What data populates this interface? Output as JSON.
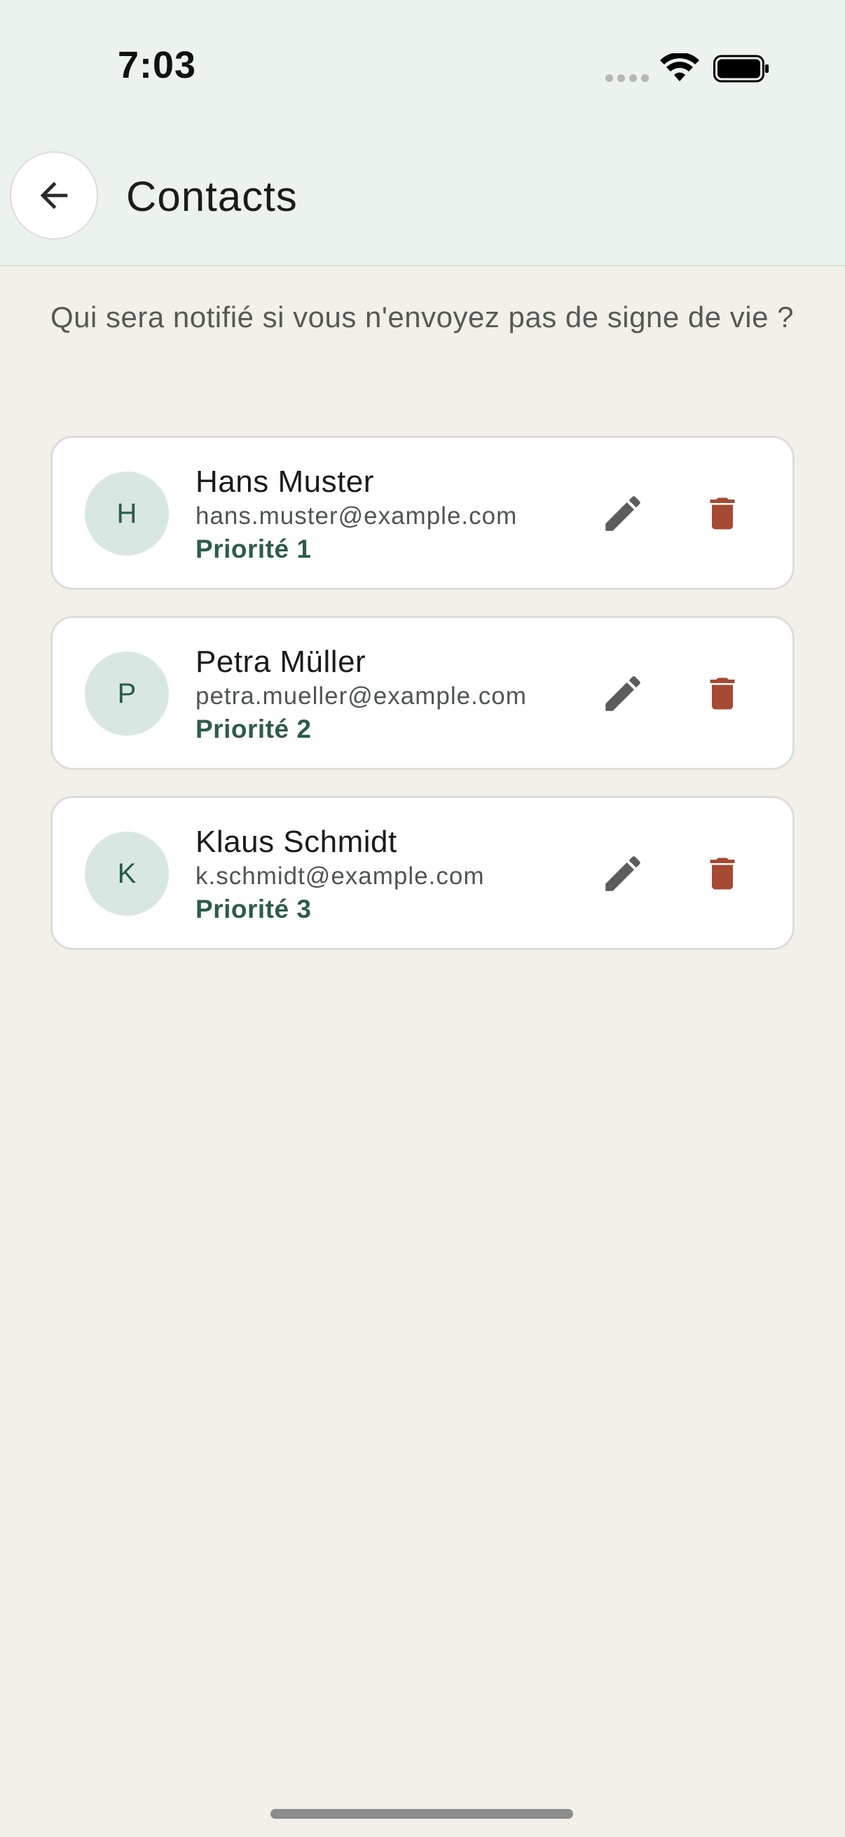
{
  "status_bar": {
    "time": "7:03",
    "icons": [
      "cellular-signal-icon",
      "wifi-icon",
      "battery-icon"
    ]
  },
  "app_bar": {
    "back_icon": "arrow-left-icon",
    "title": "Contacts"
  },
  "intro_text": "Qui sera notifié si vous n'envoyez pas de signe de vie ?",
  "contacts": [
    {
      "initial": "H",
      "name": "Hans Muster",
      "email": "hans.muster@example.com",
      "priority": "Priorité 1"
    },
    {
      "initial": "P",
      "name": "Petra Müller",
      "email": "petra.mueller@example.com",
      "priority": "Priorité 2"
    },
    {
      "initial": "K",
      "name": "Klaus Schmidt",
      "email": "k.schmidt@example.com",
      "priority": "Priorité 3"
    }
  ],
  "icons": {
    "edit": "pencil-icon",
    "delete": "trash-icon"
  },
  "colors": {
    "header_background": "#ecf2ed",
    "page_background": "#f3f0e9",
    "accent_green": "#2e5b4b",
    "avatar_background": "#d8e7e2",
    "delete_red": "#a54a33",
    "edit_gray": "#5c5c5c"
  }
}
